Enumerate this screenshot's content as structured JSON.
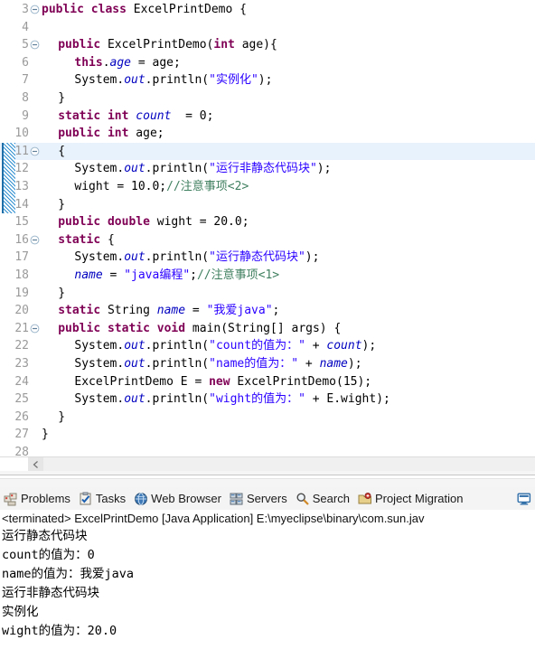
{
  "editor": {
    "first_line": 3,
    "highlighted_line": 11,
    "annotation_range": [
      11,
      14
    ],
    "colors": {
      "keyword": "#7f0055",
      "string": "#2a00ff",
      "comment": "#3f7f5f",
      "field": "#0000c0",
      "line_number": "#9a9a9a",
      "highlight_bg": "#e8f2fc",
      "annotation_bar": "#2f8fd0"
    },
    "lines": [
      {
        "n": 3,
        "fold": "collapse",
        "indent": 0,
        "tokens": [
          {
            "t": "public",
            "c": "kw"
          },
          {
            "t": " ",
            "c": "pln"
          },
          {
            "t": "class",
            "c": "kw"
          },
          {
            "t": " ExcelPrintDemo {",
            "c": "pln"
          }
        ]
      },
      {
        "n": 4,
        "fold": "",
        "indent": 0,
        "tokens": []
      },
      {
        "n": 5,
        "fold": "collapse",
        "indent": 1,
        "tokens": [
          {
            "t": "public",
            "c": "kw"
          },
          {
            "t": " ExcelPrintDemo(",
            "c": "pln"
          },
          {
            "t": "int",
            "c": "kw"
          },
          {
            "t": " age){",
            "c": "pln"
          }
        ]
      },
      {
        "n": 6,
        "fold": "",
        "indent": 2,
        "tokens": [
          {
            "t": "this",
            "c": "kw"
          },
          {
            "t": ".",
            "c": "pln"
          },
          {
            "t": "age",
            "c": "fld"
          },
          {
            "t": " = age;",
            "c": "pln"
          }
        ]
      },
      {
        "n": 7,
        "fold": "",
        "indent": 2,
        "tokens": [
          {
            "t": "System.",
            "c": "pln"
          },
          {
            "t": "out",
            "c": "fld"
          },
          {
            "t": ".println(",
            "c": "pln"
          },
          {
            "t": "\"实例化\"",
            "c": "str"
          },
          {
            "t": ");",
            "c": "pln"
          }
        ]
      },
      {
        "n": 8,
        "fold": "",
        "indent": 1,
        "tokens": [
          {
            "t": "}",
            "c": "pln"
          }
        ]
      },
      {
        "n": 9,
        "fold": "",
        "indent": 1,
        "tokens": [
          {
            "t": "static",
            "c": "kw"
          },
          {
            "t": " ",
            "c": "pln"
          },
          {
            "t": "int",
            "c": "kw"
          },
          {
            "t": " ",
            "c": "pln"
          },
          {
            "t": "count",
            "c": "fld"
          },
          {
            "t": "  = 0;",
            "c": "pln"
          }
        ]
      },
      {
        "n": 10,
        "fold": "",
        "indent": 1,
        "tokens": [
          {
            "t": "public",
            "c": "kw"
          },
          {
            "t": " ",
            "c": "pln"
          },
          {
            "t": "int",
            "c": "kw"
          },
          {
            "t": " age;",
            "c": "pln"
          }
        ]
      },
      {
        "n": 11,
        "fold": "collapse",
        "indent": 1,
        "tokens": [
          {
            "t": "{",
            "c": "pln"
          }
        ]
      },
      {
        "n": 12,
        "fold": "",
        "indent": 2,
        "tokens": [
          {
            "t": "System.",
            "c": "pln"
          },
          {
            "t": "out",
            "c": "fld"
          },
          {
            "t": ".println(",
            "c": "pln"
          },
          {
            "t": "\"运行非静态代码块\"",
            "c": "str"
          },
          {
            "t": ");",
            "c": "pln"
          }
        ]
      },
      {
        "n": 13,
        "fold": "",
        "indent": 2,
        "tokens": [
          {
            "t": "wight = 10.0;",
            "c": "pln"
          },
          {
            "t": "//注意事项<2>",
            "c": "cmt"
          }
        ]
      },
      {
        "n": 14,
        "fold": "",
        "indent": 1,
        "tokens": [
          {
            "t": "}",
            "c": "pln"
          }
        ]
      },
      {
        "n": 15,
        "fold": "",
        "indent": 1,
        "tokens": [
          {
            "t": "public",
            "c": "kw"
          },
          {
            "t": " ",
            "c": "pln"
          },
          {
            "t": "double",
            "c": "kw"
          },
          {
            "t": " wight = 20.0;",
            "c": "pln"
          }
        ]
      },
      {
        "n": 16,
        "fold": "collapse",
        "indent": 1,
        "tokens": [
          {
            "t": "static",
            "c": "kw"
          },
          {
            "t": " {",
            "c": "pln"
          }
        ]
      },
      {
        "n": 17,
        "fold": "",
        "indent": 2,
        "tokens": [
          {
            "t": "System.",
            "c": "pln"
          },
          {
            "t": "out",
            "c": "fld"
          },
          {
            "t": ".println(",
            "c": "pln"
          },
          {
            "t": "\"运行静态代码块\"",
            "c": "str"
          },
          {
            "t": ");",
            "c": "pln"
          }
        ]
      },
      {
        "n": 18,
        "fold": "",
        "indent": 2,
        "tokens": [
          {
            "t": "name",
            "c": "fld"
          },
          {
            "t": " = ",
            "c": "pln"
          },
          {
            "t": "\"java编程\"",
            "c": "str"
          },
          {
            "t": ";",
            "c": "pln"
          },
          {
            "t": "//注意事项<1>",
            "c": "cmt"
          }
        ]
      },
      {
        "n": 19,
        "fold": "",
        "indent": 1,
        "tokens": [
          {
            "t": "}",
            "c": "pln"
          }
        ]
      },
      {
        "n": 20,
        "fold": "",
        "indent": 1,
        "tokens": [
          {
            "t": "static",
            "c": "kw"
          },
          {
            "t": " String ",
            "c": "pln"
          },
          {
            "t": "name",
            "c": "fld"
          },
          {
            "t": " = ",
            "c": "pln"
          },
          {
            "t": "\"我爱java\"",
            "c": "str"
          },
          {
            "t": ";",
            "c": "pln"
          }
        ]
      },
      {
        "n": 21,
        "fold": "collapse",
        "indent": 1,
        "tokens": [
          {
            "t": "public",
            "c": "kw"
          },
          {
            "t": " ",
            "c": "pln"
          },
          {
            "t": "static",
            "c": "kw"
          },
          {
            "t": " ",
            "c": "pln"
          },
          {
            "t": "void",
            "c": "kw"
          },
          {
            "t": " main(String[] args) {",
            "c": "pln"
          }
        ]
      },
      {
        "n": 22,
        "fold": "",
        "indent": 2,
        "tokens": [
          {
            "t": "System.",
            "c": "pln"
          },
          {
            "t": "out",
            "c": "fld"
          },
          {
            "t": ".println(",
            "c": "pln"
          },
          {
            "t": "\"count的值为：\"",
            "c": "str"
          },
          {
            "t": " + ",
            "c": "pln"
          },
          {
            "t": "count",
            "c": "fld"
          },
          {
            "t": ");",
            "c": "pln"
          }
        ]
      },
      {
        "n": 23,
        "fold": "",
        "indent": 2,
        "tokens": [
          {
            "t": "System.",
            "c": "pln"
          },
          {
            "t": "out",
            "c": "fld"
          },
          {
            "t": ".println(",
            "c": "pln"
          },
          {
            "t": "\"name的值为：\"",
            "c": "str"
          },
          {
            "t": " + ",
            "c": "pln"
          },
          {
            "t": "name",
            "c": "fld"
          },
          {
            "t": ");",
            "c": "pln"
          }
        ]
      },
      {
        "n": 24,
        "fold": "",
        "indent": 2,
        "tokens": [
          {
            "t": "ExcelPrintDemo E = ",
            "c": "pln"
          },
          {
            "t": "new",
            "c": "kw"
          },
          {
            "t": " ExcelPrintDemo(15);",
            "c": "pln"
          }
        ]
      },
      {
        "n": 25,
        "fold": "",
        "indent": 2,
        "tokens": [
          {
            "t": "System.",
            "c": "pln"
          },
          {
            "t": "out",
            "c": "fld"
          },
          {
            "t": ".println(",
            "c": "pln"
          },
          {
            "t": "\"wight的值为：\"",
            "c": "str"
          },
          {
            "t": " + E.wight);",
            "c": "pln"
          }
        ]
      },
      {
        "n": 26,
        "fold": "",
        "indent": 1,
        "tokens": [
          {
            "t": "}",
            "c": "pln"
          }
        ]
      },
      {
        "n": 27,
        "fold": "",
        "indent": 0,
        "tokens": [
          {
            "t": "}",
            "c": "pln"
          }
        ]
      },
      {
        "n": 28,
        "fold": "",
        "indent": 0,
        "tokens": []
      }
    ]
  },
  "scrollbar": {
    "left_arrow": "◄"
  },
  "view_tabs": [
    {
      "label": "Problems",
      "icon": "problems-icon"
    },
    {
      "label": "Tasks",
      "icon": "tasks-icon"
    },
    {
      "label": "Web Browser",
      "icon": "web-browser-icon"
    },
    {
      "label": "Servers",
      "icon": "servers-icon"
    },
    {
      "label": "Search",
      "icon": "search-icon"
    },
    {
      "label": "Project Migration",
      "icon": "project-migration-icon"
    }
  ],
  "console_tab_icon": "console-icon",
  "console": {
    "header": "<terminated> ExcelPrintDemo [Java Application] E:\\myeclipse\\binary\\com.sun.jav",
    "output": [
      "运行静态代码块",
      "count的值为：0",
      "name的值为：我爱java",
      "运行非静态代码块",
      "实例化",
      "wight的值为：20.0"
    ]
  }
}
